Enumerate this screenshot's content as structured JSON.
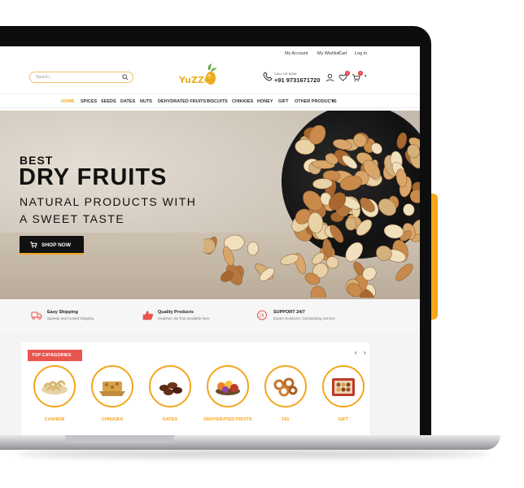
{
  "topbar": {
    "my_account": "My Account",
    "my_wishlist": "My Wishlist",
    "cart": "Cart",
    "login": "Log In"
  },
  "header": {
    "search_placeholder": "Search...",
    "logo_text": "YuZZO",
    "call_label": "CALL US NOW",
    "call_number": "+91 9731671720",
    "wishlist_count": "0",
    "cart_count": "0"
  },
  "nav": {
    "items": [
      "HOME",
      "SPICES",
      "SEEDS",
      "DATES",
      "NUTS",
      "DEHYDRATED FRUITS",
      "BISCUITS",
      "CHIKKIES",
      "HONEY",
      "GIFT",
      "OTHER PRODUCTS"
    ],
    "active": "HOME"
  },
  "hero": {
    "small": "BEST",
    "big": "DRY FRUITS",
    "sub1": "NATURAL PRODUCTS WITH",
    "sub2": "A SWEET TASTE",
    "button": "SHOP NOW"
  },
  "features": [
    {
      "title": "Easy Shipping",
      "desc": "Speedy and trusted shipping",
      "icon": "truck-icon"
    },
    {
      "title": "Quality Products",
      "desc": "Healthier dry fruit available here",
      "icon": "thumbs-up-icon"
    },
    {
      "title": "SUPPORT 24/7",
      "desc": "Expert Solutions, Outstanding Service",
      "icon": "support-24-icon"
    }
  ],
  "categories": {
    "title": "TOP CATAGORIES",
    "items": [
      "CASHEW",
      "CHIKKIES",
      "DATES",
      "DEHYDRATED FRUITS",
      "FIG",
      "GIFT"
    ]
  },
  "colors": {
    "accent": "#f4a61c",
    "title_bg": "#e8564f",
    "dark": "#111111"
  }
}
